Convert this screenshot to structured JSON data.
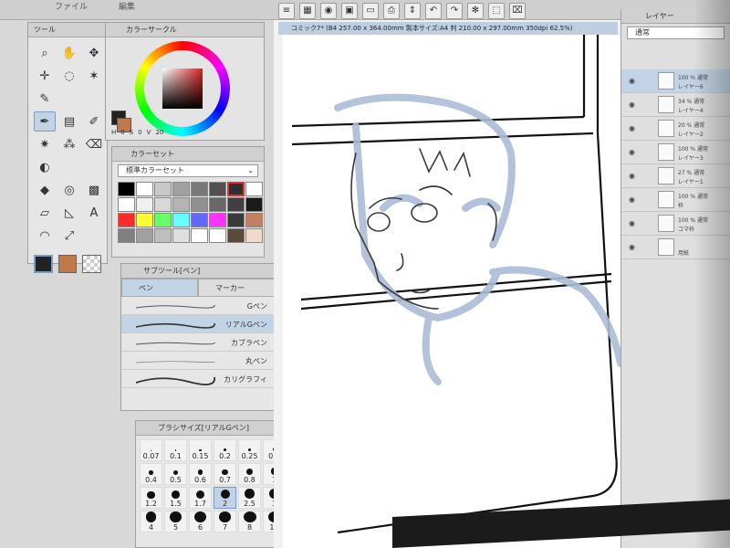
{
  "menubar": {
    "items": [
      "ファイル",
      "編集"
    ]
  },
  "toolbar": {
    "icons": [
      "menu-icon",
      "layer-icon",
      "eye-icon",
      "save-icon",
      "folder-icon",
      "print-icon",
      "adjust-icon",
      "undo-icon",
      "redo-icon",
      "spinner-icon",
      "selection-icon",
      "clear-icon"
    ]
  },
  "tool_panel": {
    "title": "ツール"
  },
  "color_circle": {
    "title": "カラーサークル",
    "h_label": "H",
    "s_label": "S",
    "v_label": "V",
    "h_value": "0",
    "s_value": "0",
    "v_value": "20",
    "accent": "#cc2222"
  },
  "color_set": {
    "title": "カラーセット",
    "selected_set": "標準カラーセット",
    "colors": [
      "#000000",
      "#ffffff",
      "#c8c8c8",
      "#a0a0a0",
      "#787878",
      "#505050",
      "#2f2f2f",
      "#ffffff",
      "#ffffff",
      "#f0f0f0",
      "#d8d8d8",
      "#b4b4b4",
      "#909090",
      "#686868",
      "#404040",
      "#1a1a1a",
      "#ff2a2a",
      "#ffff33",
      "#66ff66",
      "#66ffff",
      "#6666ff",
      "#ff33ff",
      "#3a3a3a",
      "#c28060",
      "#808080",
      "#a0a0a0",
      "#bfbfbf",
      "#dfdfdf",
      "#ffffff",
      "#ffffff",
      "#5a4a3a",
      "#f3d9c8"
    ]
  },
  "sub_tool": {
    "title": "サブツール[ペン]",
    "tabs": [
      "ペン",
      "マーカー"
    ],
    "items": [
      "Gペン",
      "リアルGペン",
      "カブラペン",
      "丸ペン",
      "カリグラフィ"
    ]
  },
  "brush_size": {
    "title": "ブラシサイズ[リアルGペン]",
    "sizes": [
      "0.07",
      "0.1",
      "0.15",
      "0.2",
      "0.25",
      "0.3",
      "0.4",
      "0.5",
      "0.6",
      "0.7",
      "0.8",
      "1",
      "1.2",
      "1.5",
      "1.7",
      "2",
      "2.5",
      "3",
      "4",
      "5",
      "6",
      "7",
      "8",
      "10"
    ],
    "active": "2"
  },
  "document": {
    "tab_label": "コミック7* (B4 257.00 x 364.00mm 製本サイズ:A4 判 210.00 x 297.00mm 350dpi 62.5%)"
  },
  "layer_panel": {
    "title": "レイヤー",
    "blend": "通常",
    "layers": [
      {
        "pct": "100 % 通常",
        "name": "レイヤー6"
      },
      {
        "pct": "34 % 通常",
        "name": "レイヤー4"
      },
      {
        "pct": "20 % 通常",
        "name": "レイヤー2"
      },
      {
        "pct": "100 % 通常",
        "name": "レイヤー3"
      },
      {
        "pct": "27 % 通常",
        "name": "レイヤー1"
      },
      {
        "pct": "100 % 通常",
        "name": "枠"
      },
      {
        "pct": "100 % 通常",
        "name": "コマ枠"
      },
      {
        "pct": "",
        "name": "用紙"
      }
    ]
  }
}
